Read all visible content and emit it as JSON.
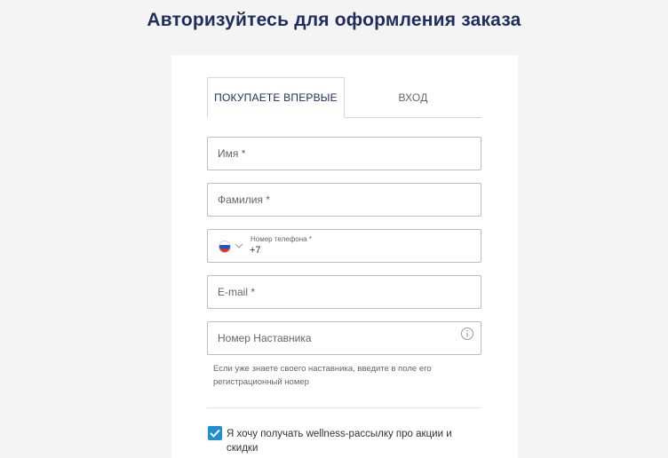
{
  "page": {
    "title": "Авторизуйтесь для оформления заказа"
  },
  "tabs": [
    {
      "label": "ПОКУПАЕТЕ ВПЕРВЫЕ",
      "active": true
    },
    {
      "label": "ВХОД",
      "active": false
    }
  ],
  "form": {
    "first_name": {
      "placeholder": "Имя *",
      "value": ""
    },
    "last_name": {
      "placeholder": "Фамилия *",
      "value": ""
    },
    "phone": {
      "label": "Номер телефона *",
      "value": "+7",
      "country_flag": "russia-flag-icon"
    },
    "email": {
      "placeholder": "E-mail *",
      "value": ""
    },
    "mentor": {
      "placeholder": "Номер Наставника",
      "value": ""
    },
    "mentor_hint": "Если уже знаете своего наставника, введите в поле его регистрационный номер",
    "newsletter": {
      "checked": true,
      "label": "Я хочу получать wellness-рассылку про акции и скидки"
    }
  },
  "colors": {
    "title": "#1d2e5e",
    "checkbox": "#1f8fd2",
    "background": "#f4f4f4",
    "card": "#ffffff"
  }
}
